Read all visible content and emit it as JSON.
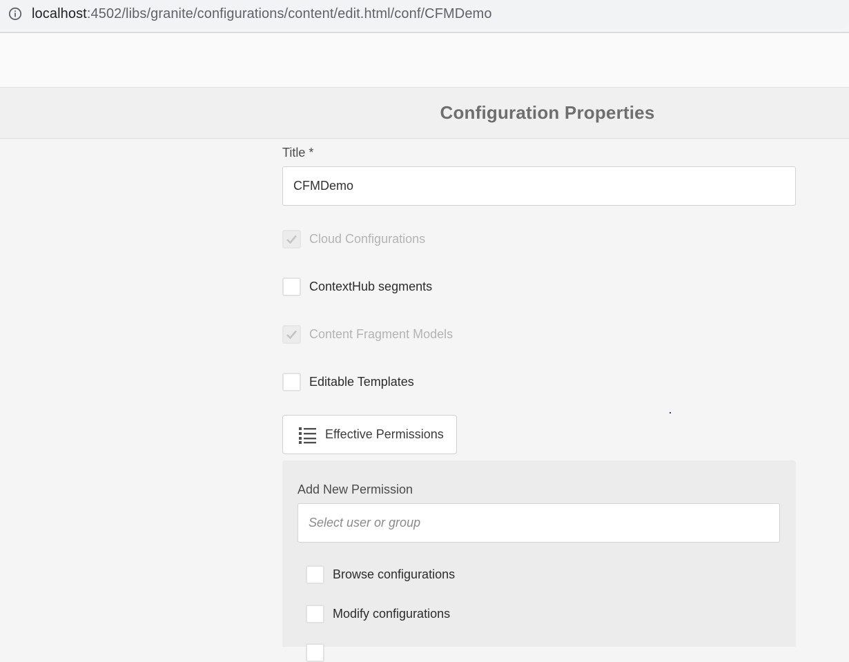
{
  "browser": {
    "url_host": "localhost",
    "url_path": ":4502/libs/granite/configurations/content/edit.html/conf/CFMDemo"
  },
  "page": {
    "title": "Configuration Properties"
  },
  "form": {
    "title_label": "Title *",
    "title_value": "CFMDemo",
    "options": [
      {
        "label": "Cloud Configurations",
        "checked": true,
        "disabled": true
      },
      {
        "label": "ContextHub segments",
        "checked": false,
        "disabled": false
      },
      {
        "label": "Content Fragment Models",
        "checked": true,
        "disabled": true
      },
      {
        "label": "Editable Templates",
        "checked": false,
        "disabled": false
      }
    ],
    "effective_permissions_label": "Effective Permissions"
  },
  "permissions": {
    "add_label": "Add New Permission",
    "user_placeholder": "Select user or group",
    "items": [
      {
        "label": "Browse configurations",
        "checked": false
      },
      {
        "label": "Modify configurations",
        "checked": false
      }
    ]
  }
}
